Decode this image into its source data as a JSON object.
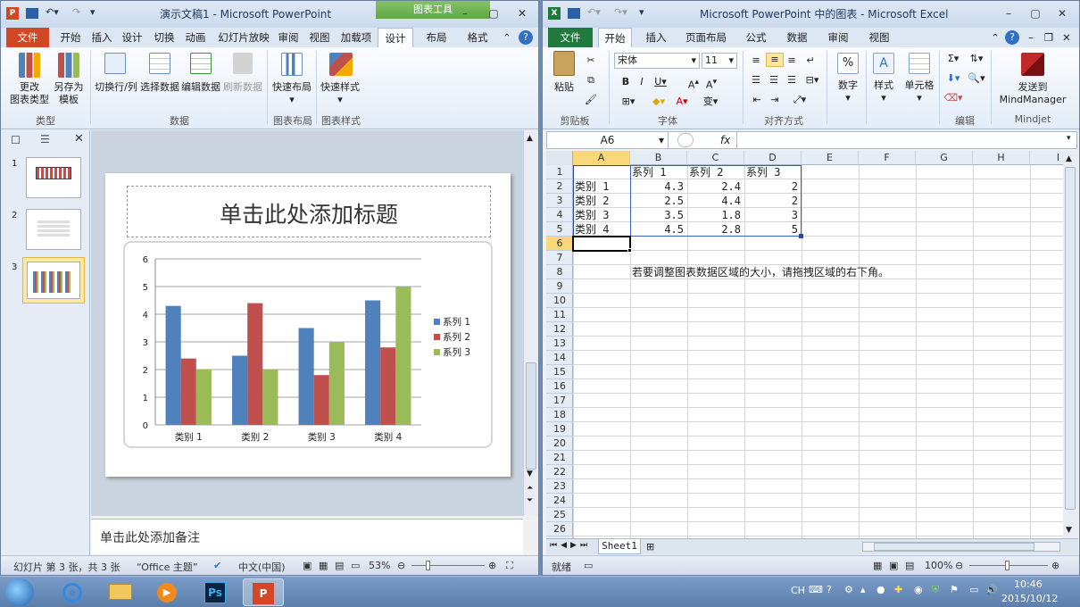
{
  "ppt": {
    "quick_access_icons": [
      "powerpoint-logo-icon",
      "save-icon",
      "undo-icon",
      "redo-icon",
      "customize-icon"
    ],
    "title": "演示文稿1 - Microsoft PowerPoint",
    "context_tab": "图表工具",
    "tabs": [
      "文件",
      "开始",
      "插入",
      "设计",
      "切换",
      "动画",
      "幻灯片放映",
      "审阅",
      "视图",
      "加载项",
      "设计",
      "布局",
      "格式"
    ],
    "ribbon": {
      "buttons": [
        {
          "label": "更改\n图表类型",
          "icon": "chart-type-icon"
        },
        {
          "label": "另存为\n模板",
          "icon": "save-template-icon"
        },
        {
          "label": "切换行/列",
          "icon": "switch-row-col-icon"
        },
        {
          "label": "选择数据",
          "icon": "select-data-icon"
        },
        {
          "label": "编辑数据",
          "icon": "edit-data-icon"
        },
        {
          "label": "刷新数据",
          "icon": "refresh-data-icon"
        },
        {
          "label": "快速布局",
          "icon": "quick-layout-icon"
        },
        {
          "label": "快速样式",
          "icon": "quick-style-icon"
        }
      ],
      "groups": [
        "类型",
        "数据",
        "图表布局",
        "图表样式"
      ]
    },
    "thumbnails": [
      "1",
      "2",
      "3"
    ],
    "slide_title": "单击此处添加标题",
    "notes_placeholder": "单击此处添加备注",
    "status": {
      "slide": "幻灯片 第 3 张，共 3 张",
      "theme": "“Office 主题”",
      "lang": "中文(中国)",
      "zoom": "53%"
    }
  },
  "chart_data": {
    "type": "bar",
    "categories": [
      "类别 1",
      "类别 2",
      "类别 3",
      "类别 4"
    ],
    "series": [
      {
        "name": "系列 1",
        "values": [
          4.3,
          2.5,
          3.5,
          4.5
        ],
        "color": "#4f81bd"
      },
      {
        "name": "系列 2",
        "values": [
          2.4,
          4.4,
          1.8,
          2.8
        ],
        "color": "#c0504d"
      },
      {
        "name": "系列 3",
        "values": [
          2,
          2,
          3,
          5
        ],
        "color": "#9bbb59"
      }
    ],
    "yticks": [
      "0",
      "1",
      "2",
      "3",
      "4",
      "5",
      "6"
    ],
    "ylim": [
      0,
      6
    ],
    "grid": true,
    "legend": "right"
  },
  "excel": {
    "quick_access_icons": [
      "excel-logo-icon",
      "save-icon",
      "undo-icon",
      "redo-icon",
      "customize-icon"
    ],
    "title": "Microsoft PowerPoint 中的图表 - Microsoft Excel",
    "tabs": [
      "文件",
      "开始",
      "插入",
      "页面布局",
      "公式",
      "数据",
      "审阅",
      "视图"
    ],
    "font_name": "宋体",
    "font_size": "11",
    "ribbon_labels": {
      "paste": "粘贴",
      "number": "数字",
      "styles": "样式",
      "cells": "单元格",
      "mindmanager": "发送到\nMindManager"
    },
    "groups": [
      "剪贴板",
      "字体",
      "对齐方式",
      "编辑",
      "Mindjet"
    ],
    "name_box": "A6",
    "fx": "fx",
    "col_headers": [
      "A",
      "B",
      "C",
      "D",
      "E",
      "F",
      "G",
      "H",
      "I"
    ],
    "rows": [
      "1",
      "2",
      "3",
      "4",
      "5",
      "6",
      "7",
      "8",
      "9",
      "10",
      "11",
      "12",
      "13",
      "14",
      "15",
      "16",
      "17",
      "18",
      "19",
      "20",
      "21",
      "22",
      "23",
      "24",
      "25",
      "26",
      "27"
    ],
    "cells": {
      "b1": "系列 1",
      "c1": "系列 2",
      "d1": "系列 3",
      "a2": "类别 1",
      "b2": "4.3",
      "c2": "2.4",
      "d2": "2",
      "a3": "类别 2",
      "b3": "2.5",
      "c3": "4.4",
      "d3": "2",
      "a4": "类别 3",
      "b4": "3.5",
      "c4": "1.8",
      "d4": "3",
      "a5": "类别 4",
      "b5": "4.5",
      "c5": "2.8",
      "d5": "5"
    },
    "hint": "若要调整图表数据区域的大小，请拖拽区域的右下角。",
    "sheet_tab": "Sheet1",
    "status": {
      "ready": "就绪",
      "zoom": "100%"
    }
  },
  "taskbar": {
    "apps": [
      "windows-start-icon",
      "internet-explorer-icon",
      "file-explorer-icon",
      "media-player-icon",
      "photoshop-icon",
      "powerpoint-icon"
    ],
    "ps_label": "Ps",
    "lang": "CH",
    "time": "10:46",
    "date": "2015/10/12"
  }
}
